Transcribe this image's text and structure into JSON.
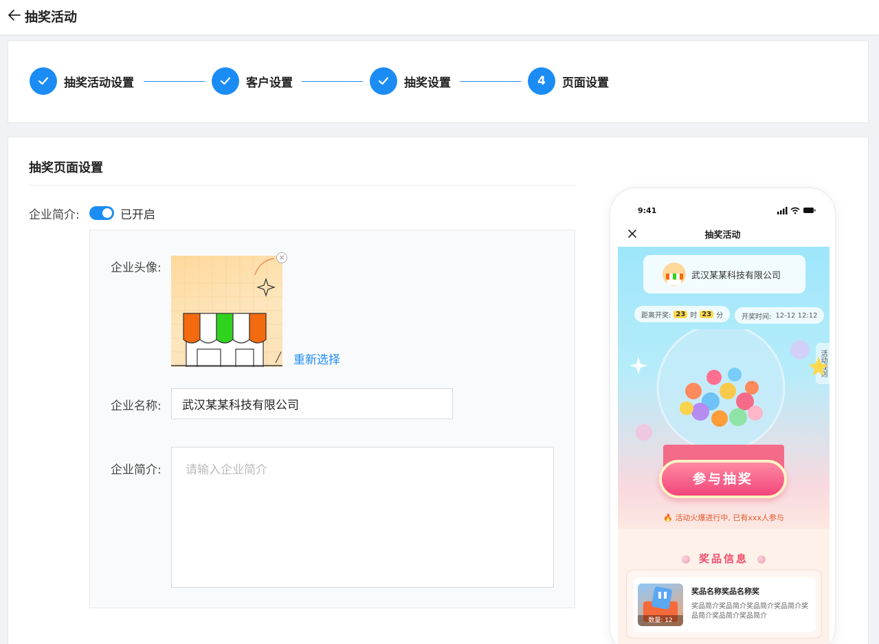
{
  "header": {
    "title": "抽奖活动"
  },
  "steps": [
    {
      "label": "抽奖活动设置",
      "status": "done"
    },
    {
      "label": "客户设置",
      "status": "done"
    },
    {
      "label": "抽奖设置",
      "status": "done"
    },
    {
      "label": "页面设置",
      "status": "current",
      "number": "4"
    }
  ],
  "section": {
    "title": "抽奖页面设置"
  },
  "company_intro_toggle": {
    "label": "企业简介:",
    "state_text": "已开启",
    "enabled": true
  },
  "form": {
    "avatar_label": "企业头像:",
    "reselect_label": "重新选择",
    "name_label": "企业名称:",
    "name_value": "武汉某某科技有限公司",
    "intro_label": "企业简介:",
    "intro_placeholder": "请输入企业简介"
  },
  "phone_preview": {
    "time": "9:41",
    "title": "抽奖活动",
    "company_name": "武汉某某科技有限公司",
    "countdown_prefix": "距离开奖:",
    "countdown_hours": "23",
    "hours_unit": "时",
    "countdown_minutes": "23",
    "minutes_unit": "分",
    "draw_time_label": "开奖时间:",
    "draw_time_value": "12-12 12:12",
    "rules_label": "活动规则",
    "join_button": "参与抽奖",
    "hot_text": "🔥 活动火爆进行中, 已有xxx人参与",
    "prize_section_title": "奖品信息",
    "prize": {
      "name": "奖品名称奖品名称奖",
      "desc": "奖品简介奖品简介奖品简介奖品简介奖品简介奖品简介奖品简介",
      "qty": "数量: 12"
    }
  },
  "colors": {
    "primary": "#1c8cf5",
    "accent_pink": "#f2467a"
  }
}
